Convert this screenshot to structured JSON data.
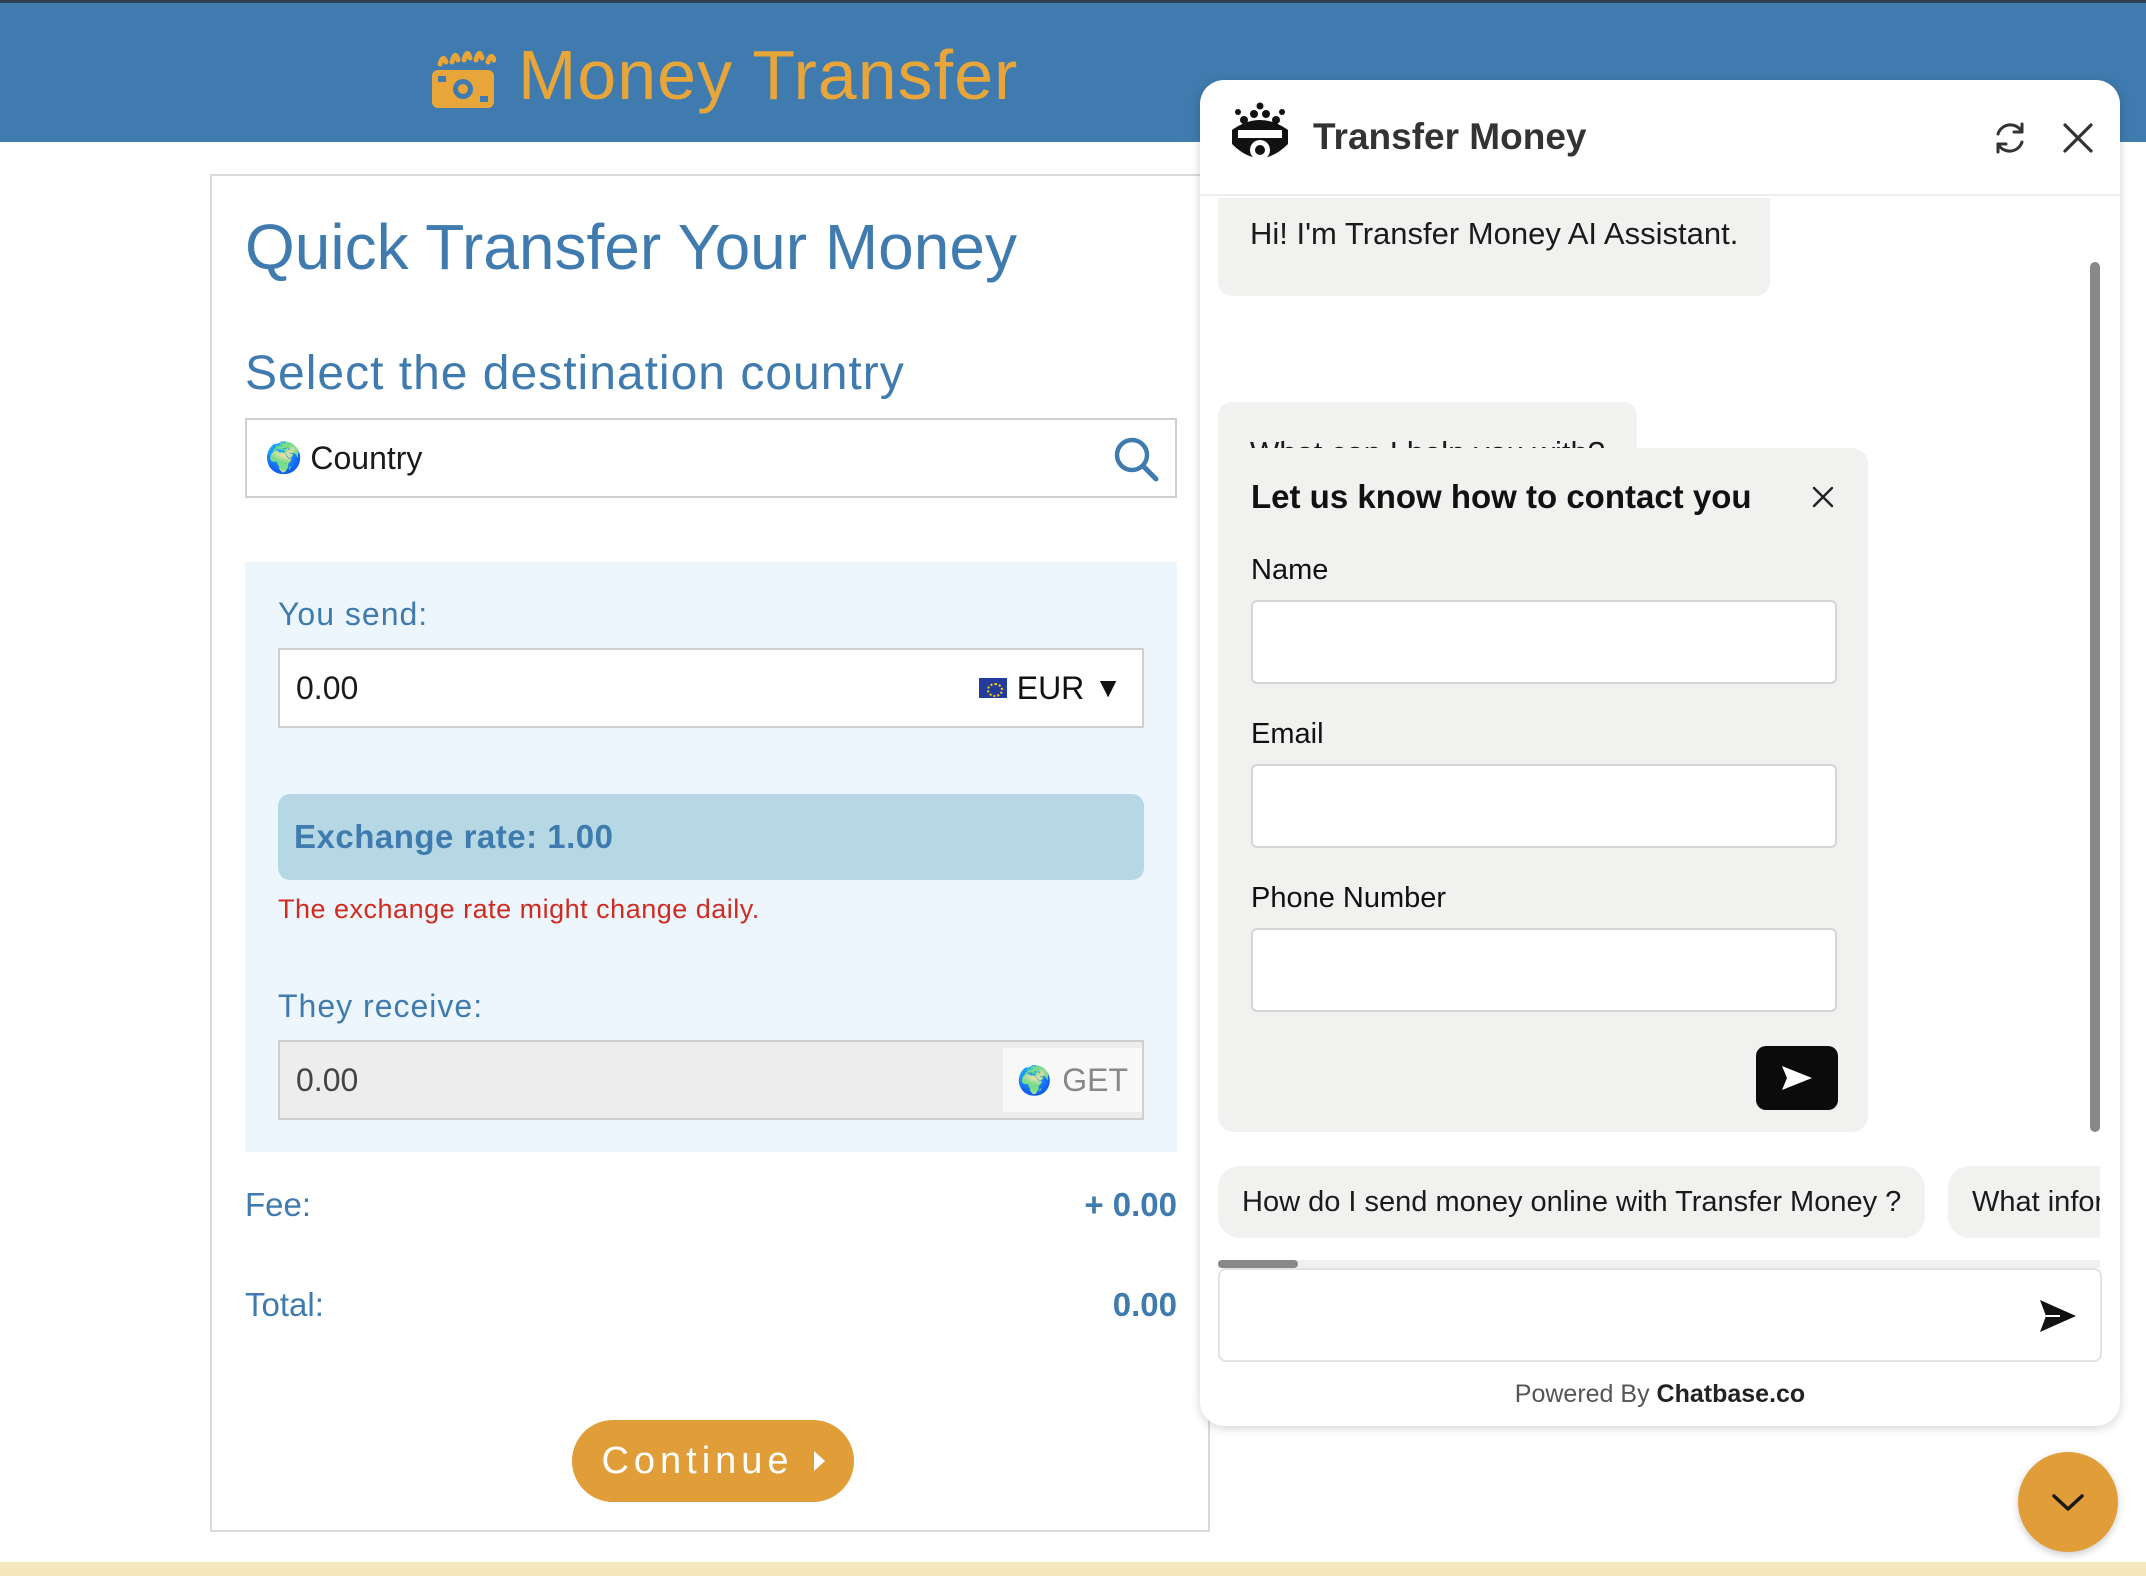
{
  "header": {
    "title": "Money Transfer",
    "logo_icon": "money-icon"
  },
  "colors": {
    "brand_blue": "#3f7bae",
    "accent_orange": "#e09d38",
    "error_red": "#d12a1f",
    "rate_bg": "#b5d8e4"
  },
  "transfer": {
    "title": "Quick Transfer Your Money",
    "destination_label": "Select the destination country",
    "country_placeholder": "Country",
    "send_label": "You send:",
    "send_value": "0.00",
    "send_currency": "EUR",
    "exchange_rate_text": "Exchange rate: 1.00",
    "rate_note": "The exchange rate might change daily.",
    "receive_label": "They receive:",
    "receive_value": "0.00",
    "receive_currency": "GET",
    "fee_label": "Fee:",
    "fee_value": "+ 0.00",
    "total_label": "Total:",
    "total_value": "0.00",
    "continue_label": "Continue"
  },
  "chat": {
    "title": "Transfer Money",
    "messages": [
      "Hi! I'm Transfer Money AI Assistant.",
      "What can I help you with?"
    ],
    "contact_form": {
      "title": "Let us know how to contact you",
      "name_label": "Name",
      "email_label": "Email",
      "phone_label": "Phone Number"
    },
    "suggestions": [
      "How do I send money online with Transfer Money ?",
      "What information do I need to send money?"
    ],
    "powered_prefix": "Powered By ",
    "powered_brand": "Chatbase.co"
  }
}
